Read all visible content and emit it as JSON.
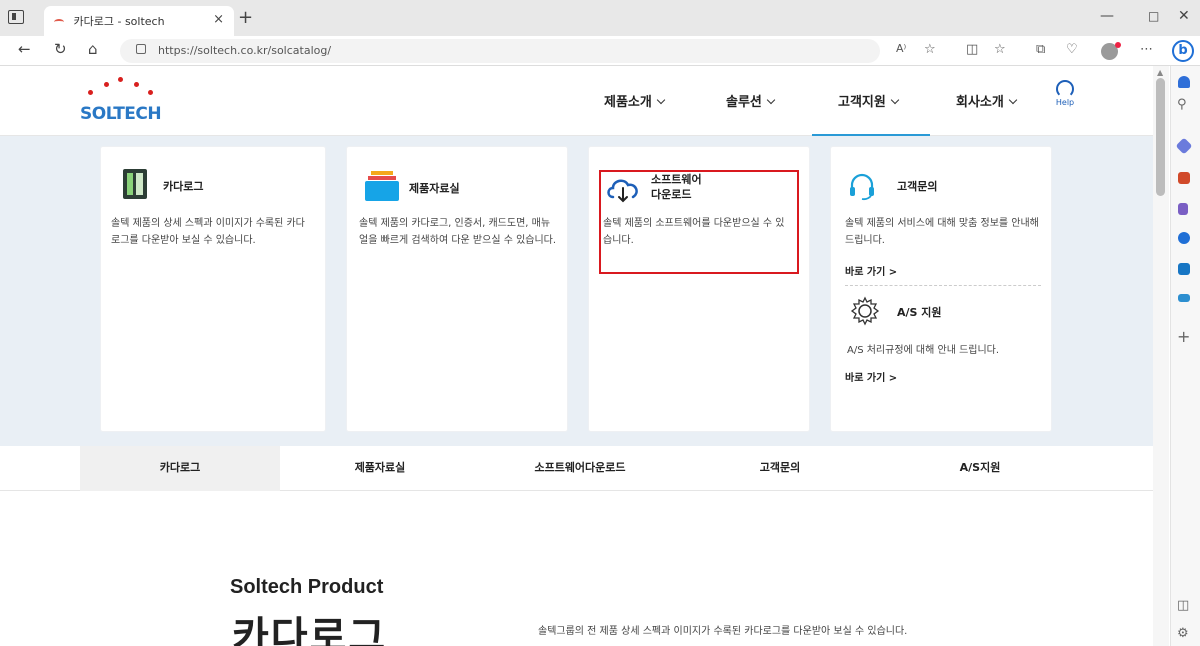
{
  "browser": {
    "tab_title": "카다로그 - soltech",
    "url": "https://soltech.co.kr/solcatalog/",
    "tab_close": "×",
    "new_tab": "+"
  },
  "header": {
    "logo": "SOLTECH",
    "menu": [
      {
        "label": "제품소개"
      },
      {
        "label": "솔루션"
      },
      {
        "label": "고객지원"
      },
      {
        "label": "회사소개"
      }
    ],
    "help_label": "Help"
  },
  "mega_menu": {
    "catalog": {
      "title": "카다로그",
      "desc": "솔텍 제품의 상세 스펙과 이미지가 수록된 카다로그를 다운받아 보실 수 있습니다."
    },
    "materials": {
      "title": "제품자료실",
      "desc": "솔텍 제품의 카다로그, 인증서, 캐드도면, 매뉴얼을 빠르게 검색하여 다운 받으실 수 있습니다."
    },
    "software": {
      "title_line1": "소프트웨어",
      "title_line2": "다운로드",
      "desc": "솔텍 제품의 소프트웨어를 다운받으실 수 있습니다."
    },
    "inquiry": {
      "title": "고객문의",
      "desc": "솔텍 제품의 서비스에 대해 맞춤 정보를 안내해 드립니다.",
      "link": "바로 가기 >"
    },
    "as": {
      "title": "A/S 지원",
      "desc": "A/S 처리규정에 대해 안내 드립니다.",
      "link": "바로 가기 >"
    }
  },
  "tabnav": [
    "카다로그",
    "제품자료실",
    "소프트웨어다운로드",
    "고객문의",
    "A/S지원"
  ],
  "hero": {
    "subtitle": "Soltech Product",
    "title": "카다로그",
    "desc": "솔텍그룹의 전 제품 상세 스펙과 이미지가 수록된 카다로그를 다운받아 보실 수 있습니다."
  },
  "colors": {
    "accent": "#2a9ad6",
    "highlight": "#d9191f",
    "logo_blue": "#2a78c5",
    "panel_bg": "#e9eff5"
  }
}
